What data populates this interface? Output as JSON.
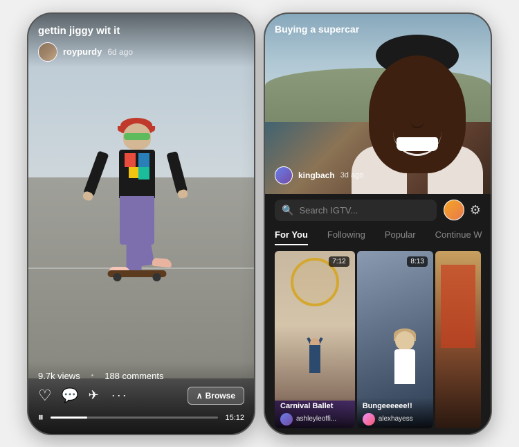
{
  "leftPhone": {
    "title": "gettin jiggy wit it",
    "user": {
      "username": "roypurdy",
      "timeAgo": "6d ago"
    },
    "stats": {
      "views": "9.7k views",
      "comments": "188 comments"
    },
    "actions": {
      "browse": "Browse"
    },
    "duration": "15:12",
    "progressPercent": 22
  },
  "rightPhone": {
    "videoTitle": "Buying a supercar",
    "user": {
      "username": "kingbach",
      "timeAgo": "3d ago"
    },
    "search": {
      "placeholder": "Search IGTV..."
    },
    "tabs": [
      {
        "label": "For You",
        "active": true
      },
      {
        "label": "Following",
        "active": false
      },
      {
        "label": "Popular",
        "active": false
      },
      {
        "label": "Continue W",
        "active": false
      }
    ],
    "grid": [
      {
        "title": "Carnival Ballet",
        "username": "ashleyleoffi...",
        "duration": "7:12"
      },
      {
        "title": "Bungeeeeee!!",
        "username": "alexhayess",
        "duration": "8:13"
      },
      {
        "title": "",
        "username": "",
        "duration": ""
      }
    ]
  }
}
